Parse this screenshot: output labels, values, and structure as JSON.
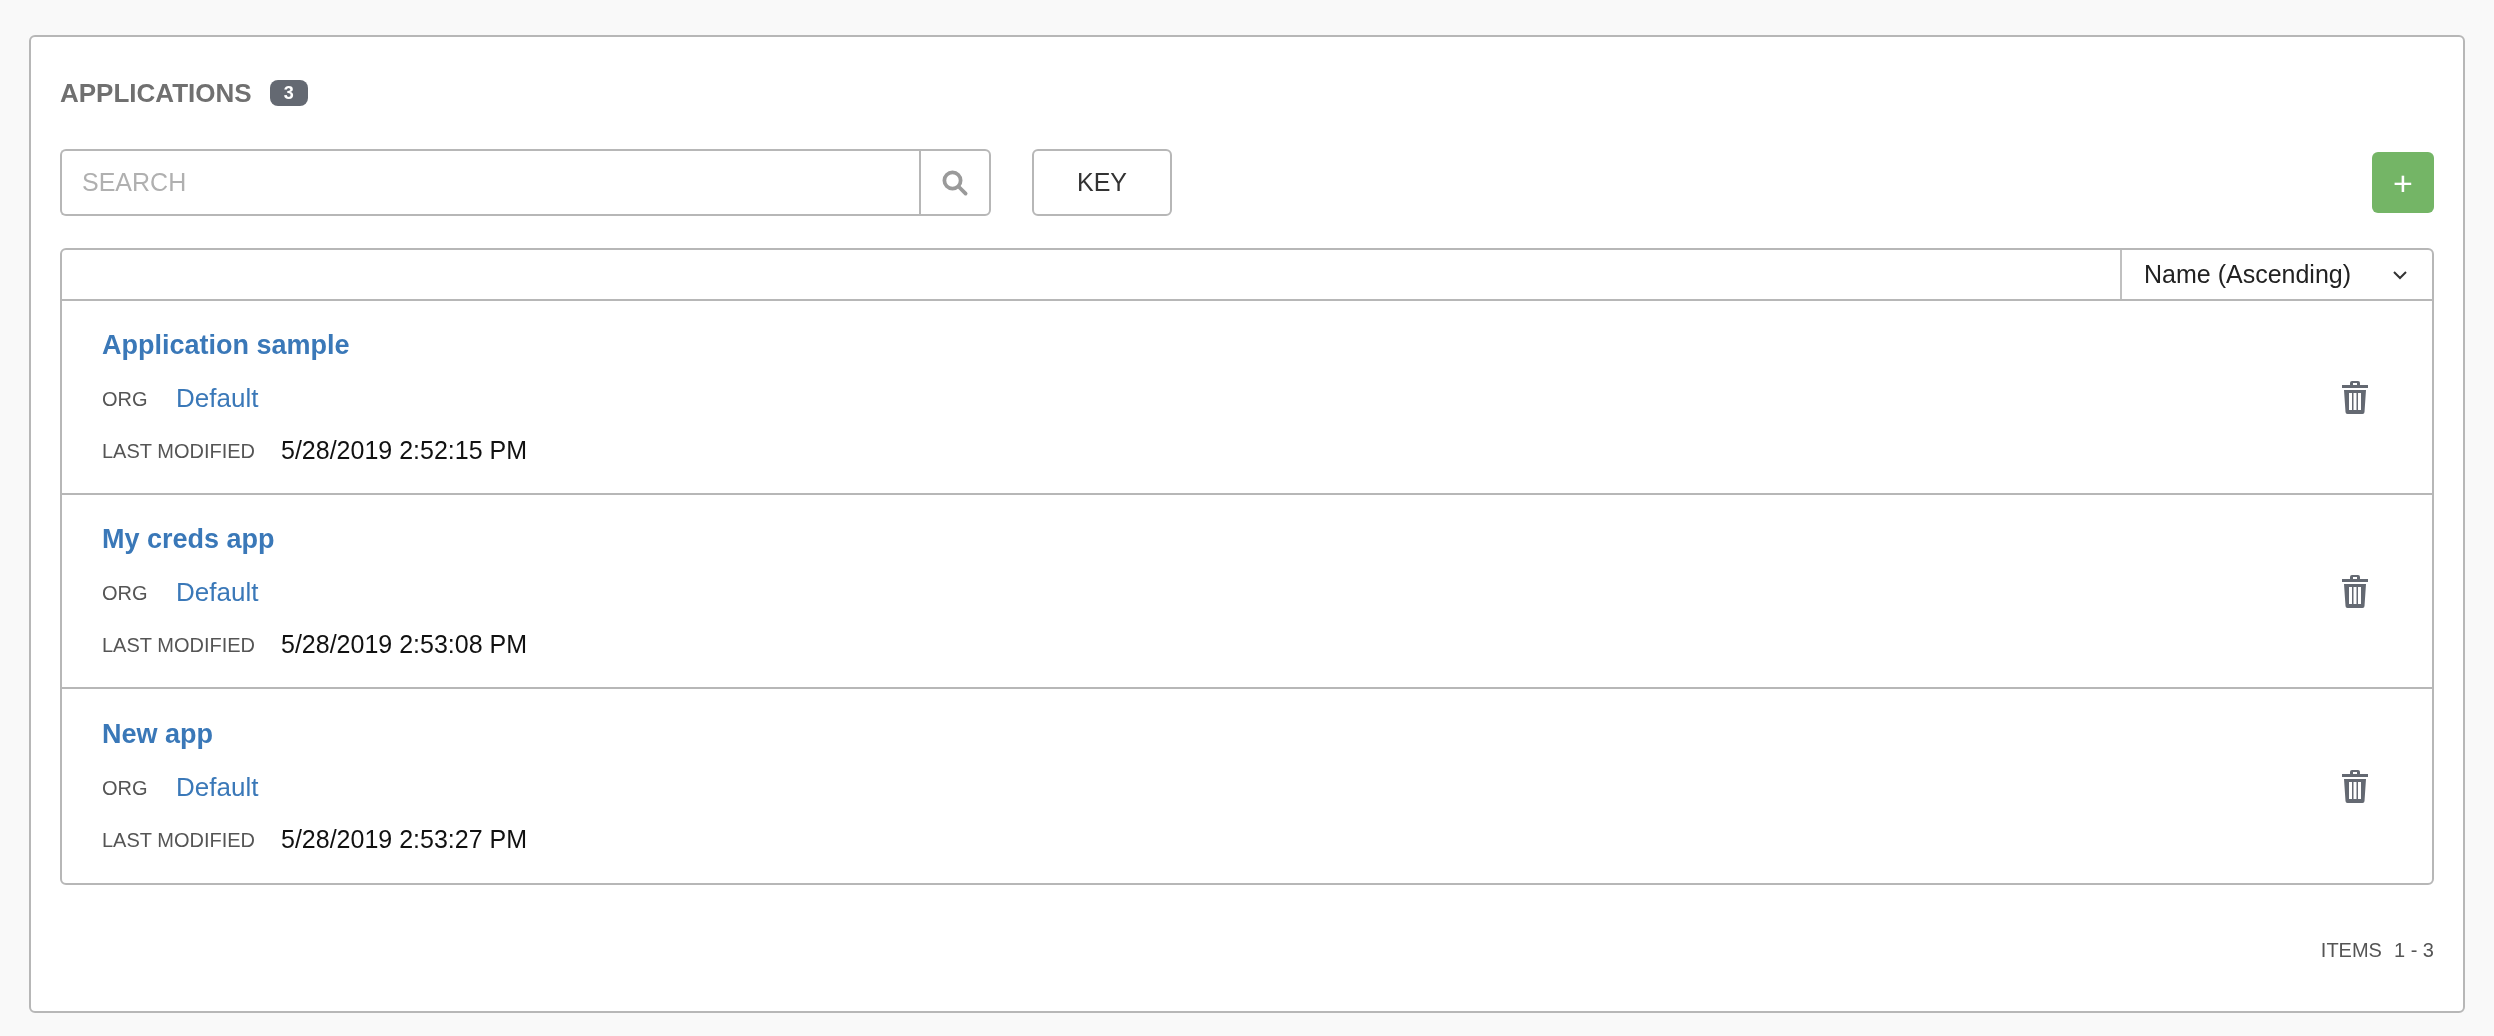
{
  "panel": {
    "title": "APPLICATIONS",
    "count": "3"
  },
  "toolbar": {
    "search": {
      "placeholder": "SEARCH"
    },
    "key_button": "KEY",
    "add_button": "+"
  },
  "list": {
    "sort": "Name (Ascending)",
    "rows": [
      {
        "name": "Application sample",
        "org_label": "ORG",
        "org": "Default",
        "modified_label": "LAST MODIFIED",
        "modified": "5/28/2019 2:52:15 PM"
      },
      {
        "name": "My creds app",
        "org_label": "ORG",
        "org": "Default",
        "modified_label": "LAST MODIFIED",
        "modified": "5/28/2019 2:53:08 PM"
      },
      {
        "name": "New app",
        "org_label": "ORG",
        "org": "Default",
        "modified_label": "LAST MODIFIED",
        "modified": "5/28/2019 2:53:27 PM"
      }
    ]
  },
  "footer": {
    "items_label": "ITEMS",
    "items_range": "1 - 3"
  }
}
